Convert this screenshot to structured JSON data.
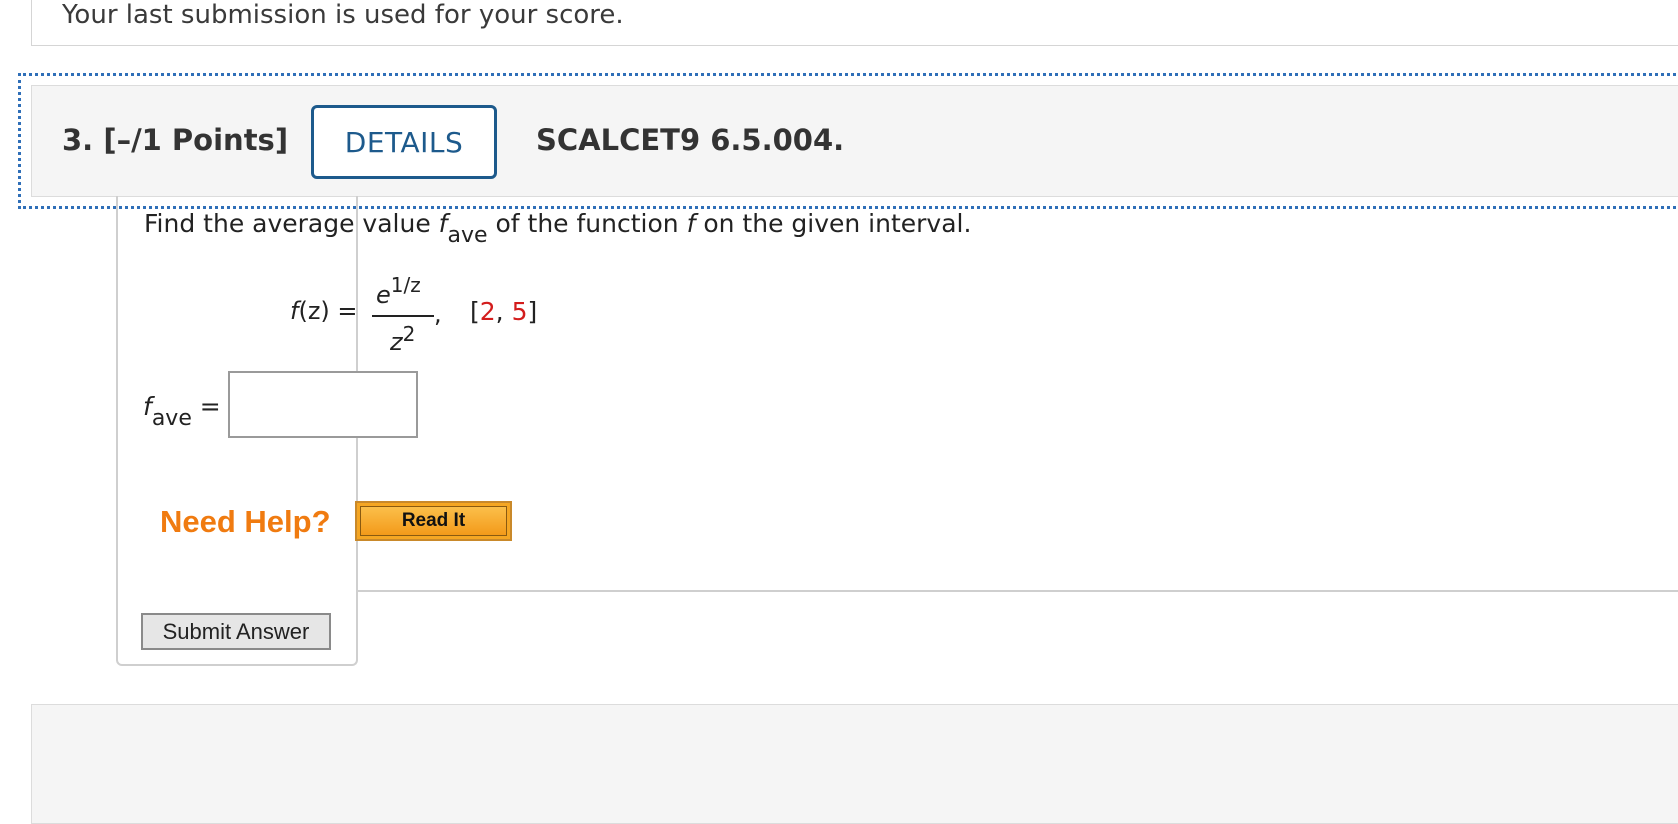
{
  "previous_question": {
    "note": "Your last submission is used for your score."
  },
  "question": {
    "number": "3.",
    "points": "[–/1 Points]",
    "details_label": "DETAILS",
    "code": "SCALCET9 6.5.004.",
    "prompt_before": "Find the average value ",
    "prompt_f": "f",
    "prompt_sub": "ave",
    "prompt_mid": " of the function ",
    "prompt_f2": "f",
    "prompt_after": " on the given interval.",
    "formula": {
      "lhs_f": "f",
      "lhs_rest": "(z)  =",
      "num_base": "e",
      "num_exp": "1/z",
      "den_base": "z",
      "den_exp": "2",
      "comma": ",",
      "interval_open": "[",
      "interval_a": "2",
      "interval_sep": ", ",
      "interval_b": "5",
      "interval_close": "]"
    },
    "answer": {
      "label_f": "f",
      "label_sub": "ave",
      "label_eq": " =",
      "value": ""
    },
    "help": {
      "need_help": "Need Help?",
      "read_it": "Read It"
    },
    "submit_label": "Submit Answer"
  },
  "colors": {
    "details_border": "#1d5a8c",
    "focus_outline": "#2f6fb8",
    "need_help": "#f07b10",
    "interval_values": "#d31c1c",
    "read_it_bg": "#f5a623"
  }
}
